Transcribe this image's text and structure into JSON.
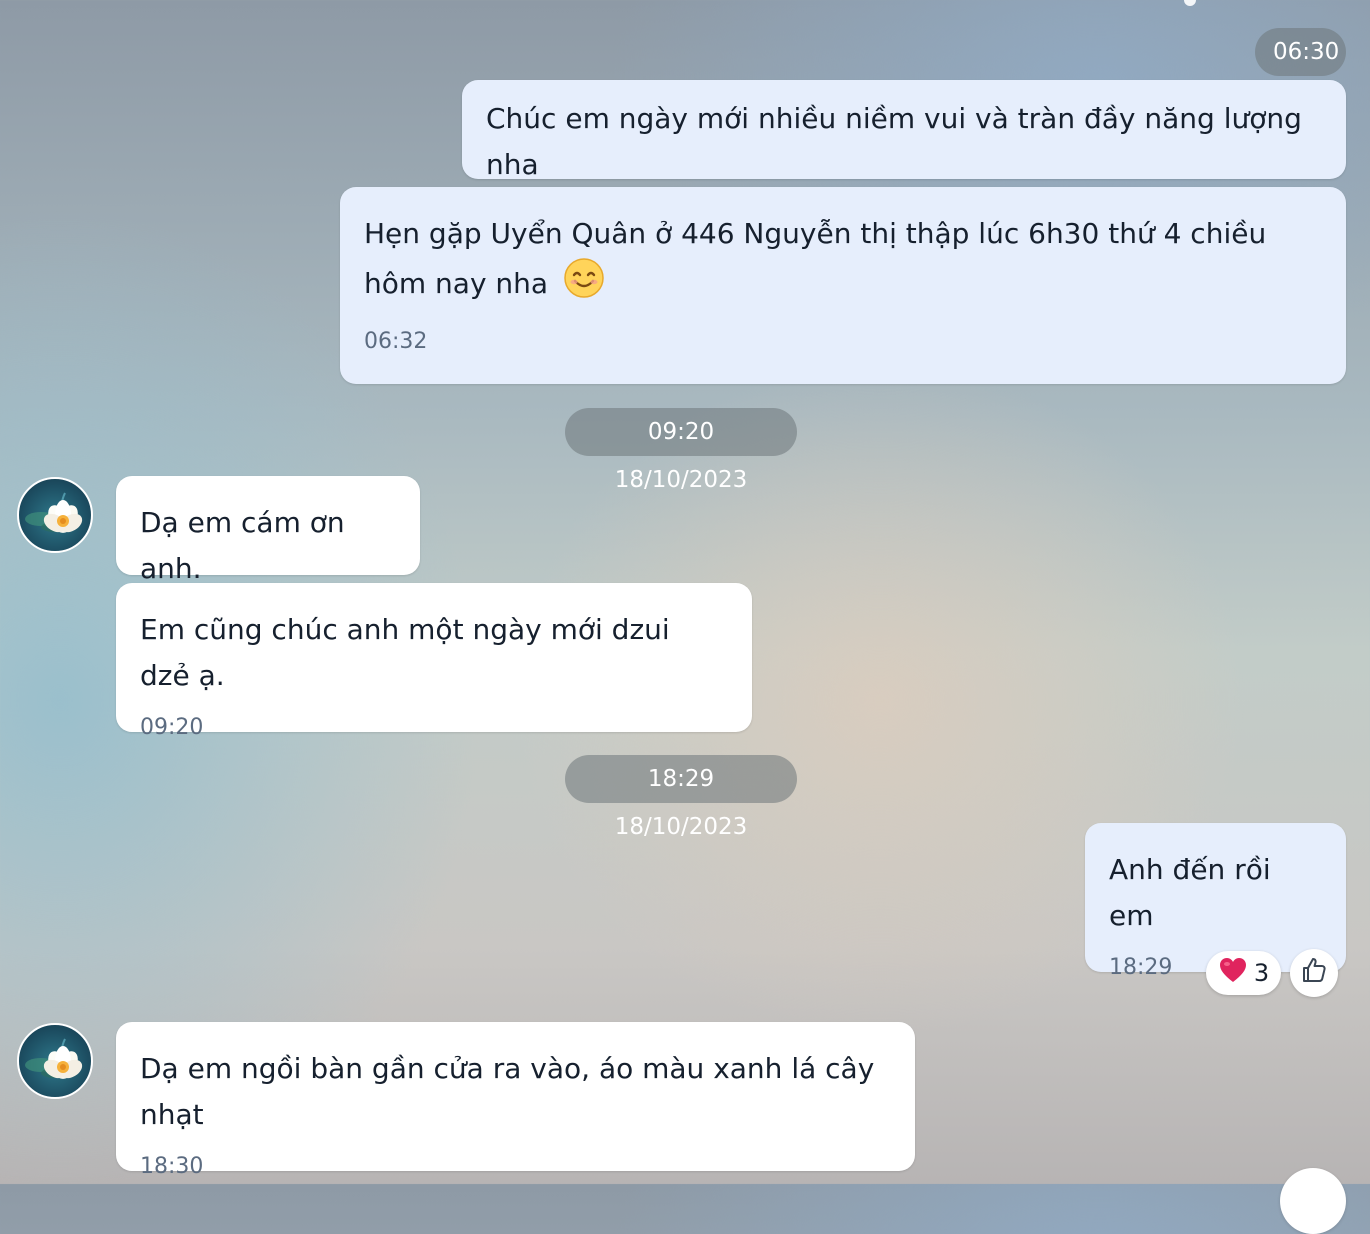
{
  "conversation": {
    "messages": [
      {
        "side": "out",
        "time_pill": "06:30",
        "text": "Chúc em ngày mới nhiều niềm vui và tràn đầy năng lượng nha"
      },
      {
        "side": "out",
        "text": "Hẹn gặp Uyển Quân ở 446 Nguyễn thị thập lúc 6h30 thứ 4 chiều hôm nay nha",
        "emoji": "smiling-face-emoji",
        "time": "06:32"
      },
      {
        "separator": "09:20 18/10/2023"
      },
      {
        "side": "in",
        "text": "Dạ em cám ơn anh."
      },
      {
        "side": "in",
        "text": "Em cũng chúc anh một ngày mới dzui dzẻ ạ.",
        "time": "09:20"
      },
      {
        "separator": "18:29 18/10/2023"
      },
      {
        "side": "out",
        "text": "Anh đến rồi em",
        "time": "18:29",
        "reaction": {
          "icon": "heart-icon",
          "count": "3"
        },
        "like_icon": "thumbs-up-icon"
      },
      {
        "side": "in",
        "text": "Dạ em ngồi bàn gần cửa ra vào, áo màu xanh lá cây nhạt",
        "time": "18:30"
      }
    ]
  },
  "colors": {
    "outgoing_bubble": "#e6eefc",
    "incoming_bubble": "#ffffff",
    "time_text": "#5b6b80",
    "separator_pill": "#6e767a",
    "heart": "#e0245e"
  }
}
